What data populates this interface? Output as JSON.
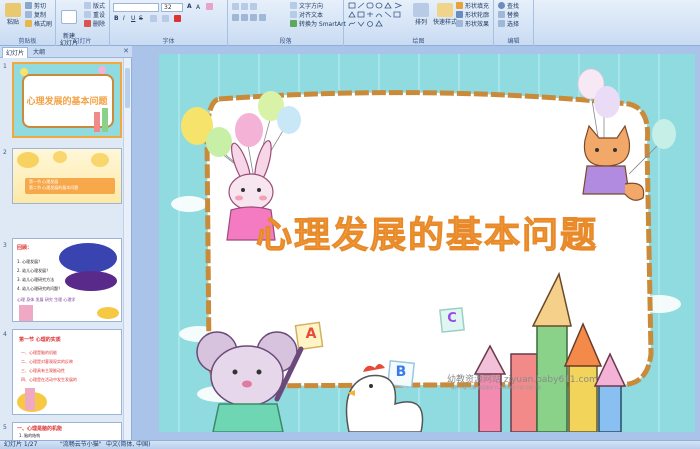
{
  "ribbon": {
    "clipboard": {
      "paste": "粘贴",
      "cut": "剪切",
      "copy": "复制",
      "painter": "格式刷",
      "label": "剪贴板"
    },
    "slides": {
      "new_slide": "新建\n幻灯片",
      "layout": "版式",
      "reset": "重设",
      "delete": "删除",
      "label": "幻灯片"
    },
    "font": {
      "size": "32",
      "bold": "B",
      "italic": "I",
      "underline": "U",
      "strike": "S",
      "label": "字体"
    },
    "paragraph": {
      "text_dir": "文字方向",
      "align_text": "对齐文本",
      "smartart": "转换为 SmartArt",
      "label": "段落"
    },
    "drawing": {
      "arrange": "排列",
      "quick_styles": "快速样式",
      "fill": "形状填充",
      "outline": "形状轮廓",
      "effects": "形状效果",
      "label": "绘图"
    },
    "editing": {
      "find": "查找",
      "replace": "替换",
      "select": "选择",
      "label": "编辑"
    }
  },
  "panel": {
    "tabs": [
      "幻灯片",
      "大纲"
    ],
    "slides": [
      {
        "num": "1",
        "title": "心理发展的基本问题"
      },
      {
        "num": "2",
        "line1": "第一节 心理发展",
        "line2": "第二节 心理发展的基本问题"
      },
      {
        "num": "3",
        "heading": "回顾：",
        "items": [
          "1. 心理发展？",
          "2. 幼儿心理发展？",
          "3. 幼儿心理研究方法",
          "4. 幼儿心理研究的问题？"
        ],
        "footer": "心理 身体 发展 研究 生理 心理学"
      },
      {
        "num": "4",
        "heading": "第一节 心理的实质",
        "items": [
          "一、心理是脑的机能",
          "二、心理是对客观现实的反映",
          "三、心理具有主观能动性",
          "四、心理是在活动中发生发展的"
        ]
      },
      {
        "num": "5",
        "heading": "一、心理是脑的机能",
        "sub": "1. 脑的结构"
      }
    ]
  },
  "slide": {
    "title": "心理发展的基本问题",
    "letters": [
      "A",
      "B",
      "C"
    ],
    "watermark": "幼教资源网站 ziyuan.baby611.com",
    "watermark_sub": "课件下载   儿歌   教案素材   FLASH课件下载   试卷下载"
  },
  "status": {
    "slide_count": "幻灯片 1/27",
    "theme": "\"流畅云节小猫\"",
    "language": "中文(简体, 中国)"
  },
  "colors": {
    "slide_bg": "#8fdbe0",
    "title_orange": "#f4a245",
    "frame_brown": "#c98a3a",
    "ribbon_bg": "#dbe7f6"
  }
}
